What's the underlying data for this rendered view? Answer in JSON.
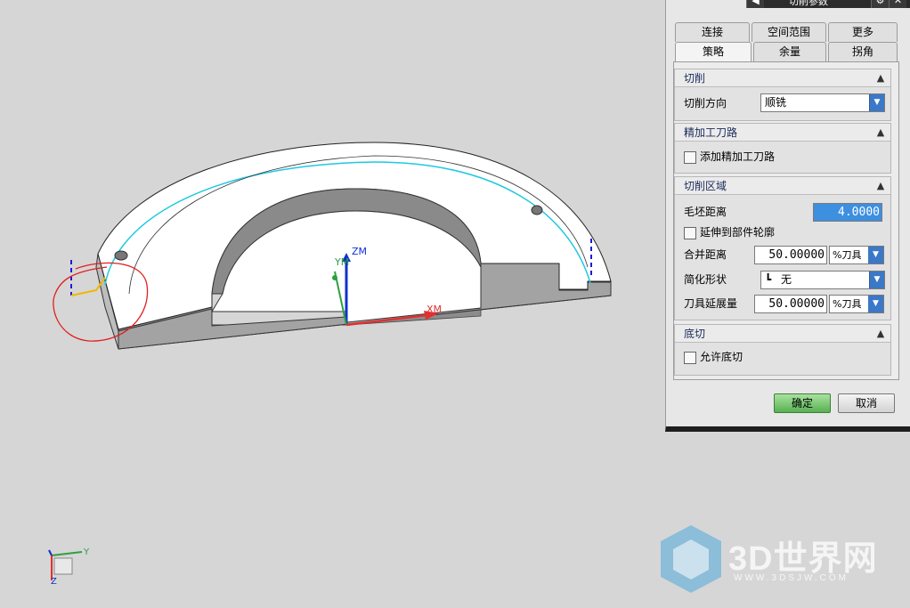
{
  "viewport": {
    "axis_labels": {
      "zm": "ZM",
      "ym": "YM",
      "xm": "XM"
    },
    "triad_labels": {
      "y": "Y",
      "z": "Z"
    }
  },
  "dialog": {
    "title": "切削参数",
    "tabs_top": [
      "连接",
      "空间范围",
      "更多"
    ],
    "tabs_bottom": [
      "策略",
      "余量",
      "拐角"
    ],
    "active_tab": "策略",
    "sections": {
      "cutting": {
        "title": "切削",
        "cut_direction_label": "切削方向",
        "cut_direction_value": "顺铣"
      },
      "finish_path": {
        "title": "精加工刀路",
        "add_finish_path_label": "添加精加工刀路"
      },
      "cut_region": {
        "title": "切削区域",
        "blank_distance_label": "毛坯距离",
        "blank_distance_value": "4.0000",
        "extend_to_part_outline_label": "延伸到部件轮廓",
        "merge_distance_label": "合并距离",
        "merge_distance_value": "50.00000",
        "merge_distance_unit": "%刀具",
        "simplify_shape_label": "简化形状",
        "simplify_shape_value": "无",
        "tool_extension_label": "刀具延展量",
        "tool_extension_value": "50.00000",
        "tool_extension_unit": "%刀具"
      },
      "undercut": {
        "title": "底切",
        "allow_undercut_label": "允许底切"
      }
    },
    "ok_label": "确定",
    "cancel_label": "取消"
  },
  "watermark": {
    "brand": "3D世界网",
    "url": "WWW.3DSJW.COM"
  },
  "colors": {
    "background": "#d6d6d6",
    "accent_blue": "#3b78c8",
    "ok_green": "#57b151",
    "toolpath_cyan": "#1fc8e0"
  }
}
